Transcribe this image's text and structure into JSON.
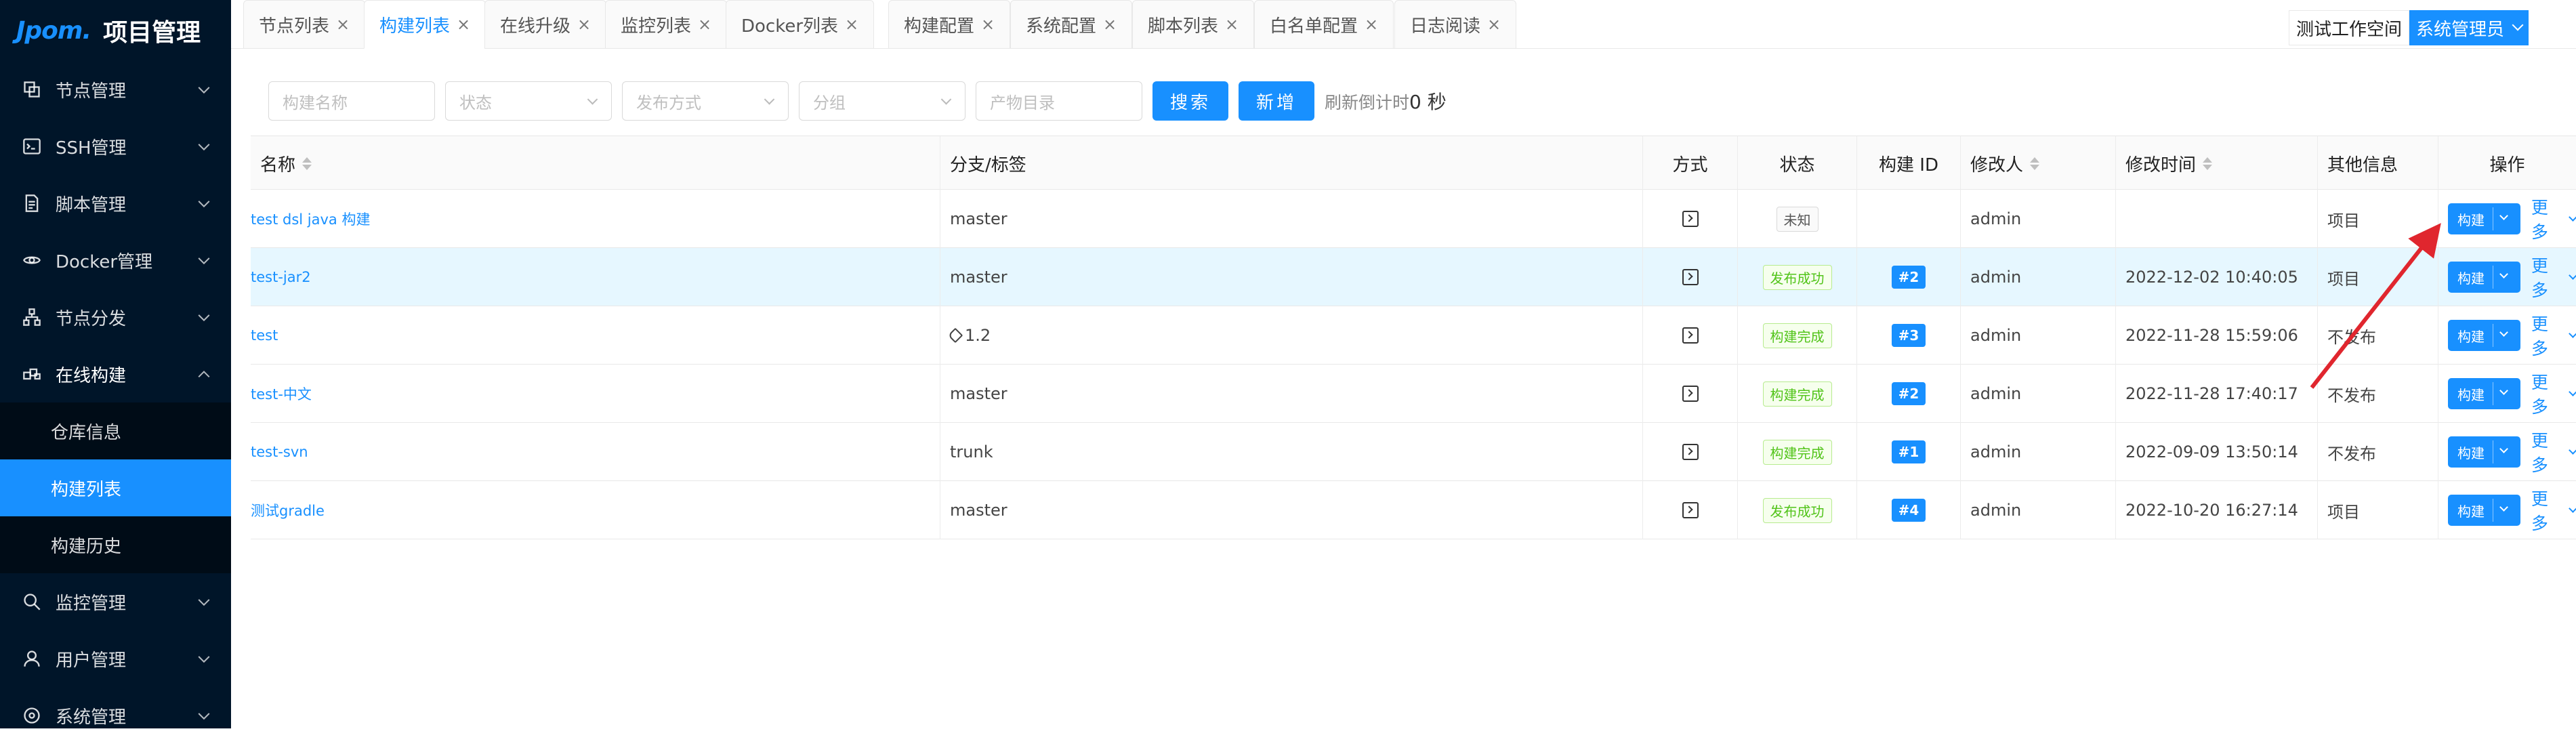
{
  "app": {
    "logo": "Jpom.",
    "title": "项目管理"
  },
  "sidebar": {
    "items": [
      {
        "label": "节点管理",
        "icon": "node-icon"
      },
      {
        "label": "SSH管理",
        "icon": "terminal-icon"
      },
      {
        "label": "脚本管理",
        "icon": "file-icon"
      },
      {
        "label": "Docker管理",
        "icon": "docker-icon"
      },
      {
        "label": "节点分发",
        "icon": "cluster-icon"
      },
      {
        "label": "在线构建",
        "icon": "build-icon"
      },
      {
        "label": "监控管理",
        "icon": "monitor-icon"
      },
      {
        "label": "用户管理",
        "icon": "user-icon"
      },
      {
        "label": "系统管理",
        "icon": "settings-icon"
      }
    ],
    "submenu": [
      "仓库信息",
      "构建列表",
      "构建历史"
    ],
    "active_submenu": "构建列表"
  },
  "tabs": [
    {
      "label": "节点列表"
    },
    {
      "label": "构建列表"
    },
    {
      "label": "在线升级"
    },
    {
      "label": "监控列表"
    },
    {
      "label": "Docker列表"
    },
    {
      "label": "构建配置"
    },
    {
      "label": "系统配置"
    },
    {
      "label": "脚本列表"
    },
    {
      "label": "白名单配置"
    },
    {
      "label": "日志阅读"
    }
  ],
  "tab_close": "×",
  "workspace": {
    "label": "测试工作空间",
    "user": "系统管理员"
  },
  "filters": {
    "name_placeholder": "构建名称",
    "status_placeholder": "状态",
    "publish_placeholder": "发布方式",
    "group_placeholder": "分组",
    "dir_placeholder": "产物目录",
    "search_button": "搜索",
    "add_button": "新增",
    "countdown_label": "刷新倒计时",
    "countdown_value": "0 秒"
  },
  "table": {
    "headers": {
      "name": "名称",
      "branch": "分支/标签",
      "method": "方式",
      "status": "状态",
      "build_id": "构建 ID",
      "modifier": "修改人",
      "modify_time": "修改时间",
      "other": "其他信息",
      "actions": "操作"
    },
    "build_label": "构建",
    "more_label": "更多",
    "rows": [
      {
        "name": "test dsl java 构建",
        "branch": "master",
        "status": "未知",
        "status_type": "default",
        "build_id": "",
        "modifier": "admin",
        "modify_time": "",
        "other": "项目"
      },
      {
        "name": "test-jar2",
        "branch": "master",
        "status": "发布成功",
        "status_type": "green",
        "build_id": "#2",
        "modifier": "admin",
        "modify_time": "2022-12-02 10:40:05",
        "other": "项目"
      },
      {
        "name": "test",
        "branch": "1.2",
        "branch_tag": true,
        "status": "构建完成",
        "status_type": "green",
        "build_id": "#3",
        "modifier": "admin",
        "modify_time": "2022-11-28 15:59:06",
        "other": "不发布"
      },
      {
        "name": "test-中文",
        "branch": "master",
        "status": "构建完成",
        "status_type": "green",
        "build_id": "#2",
        "modifier": "admin",
        "modify_time": "2022-11-28 17:40:17",
        "other": "不发布"
      },
      {
        "name": "test-svn",
        "branch": "trunk",
        "status": "构建完成",
        "status_type": "green",
        "build_id": "#1",
        "modifier": "admin",
        "modify_time": "2022-09-09 13:50:14",
        "other": "不发布"
      },
      {
        "name": "测试gradle",
        "branch": "master",
        "status": "发布成功",
        "status_type": "green",
        "build_id": "#4",
        "modifier": "admin",
        "modify_time": "2022-10-20 16:27:14",
        "other": "项目"
      }
    ]
  },
  "colors": {
    "primary": "#1890ff",
    "sidebar_bg": "#001529",
    "success": "#52c41a",
    "annotation_arrow": "#e0262e"
  }
}
